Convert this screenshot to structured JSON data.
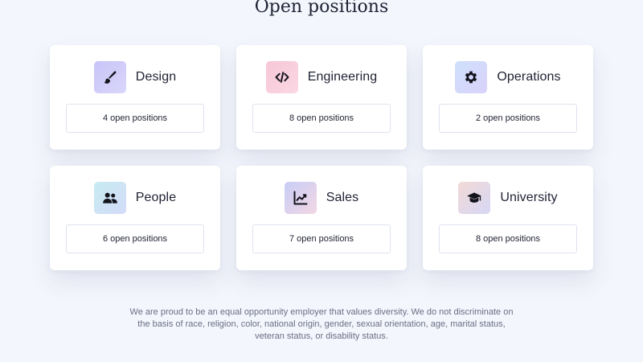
{
  "page": {
    "title": "Open positions",
    "footer_note": "We are proud to be an equal opportunity employer that values diversity. We do not discriminate on the basis of race, religion, color, national origin, gender, sexual orientation, age, marital status, veteran status, or disability status."
  },
  "departments": [
    {
      "name": "Design",
      "icon": "paintbrush-icon",
      "positions_label": "4 open positions",
      "tile_gradient": [
        "#c9c4f7",
        "#d9d6fb"
      ]
    },
    {
      "name": "Engineering",
      "icon": "code-icon",
      "positions_label": "8 open positions",
      "tile_gradient": [
        "#f7c6d6",
        "#fbd8e3"
      ]
    },
    {
      "name": "Operations",
      "icon": "gear-icon",
      "positions_label": "2 open positions",
      "tile_gradient": [
        "#cfe0fb",
        "#d9d2fb"
      ]
    },
    {
      "name": "People",
      "icon": "users-icon",
      "positions_label": "6 open positions",
      "tile_gradient": [
        "#c7ecf1",
        "#d4dbf8"
      ]
    },
    {
      "name": "Sales",
      "icon": "chart-line-icon",
      "positions_label": "7 open positions",
      "tile_gradient": [
        "#c8cdf6",
        "#f2d7e4"
      ]
    },
    {
      "name": "University",
      "icon": "graduation-cap-icon",
      "positions_label": "8 open positions",
      "tile_gradient": [
        "#f3d9d6",
        "#d6d8f5"
      ]
    }
  ]
}
